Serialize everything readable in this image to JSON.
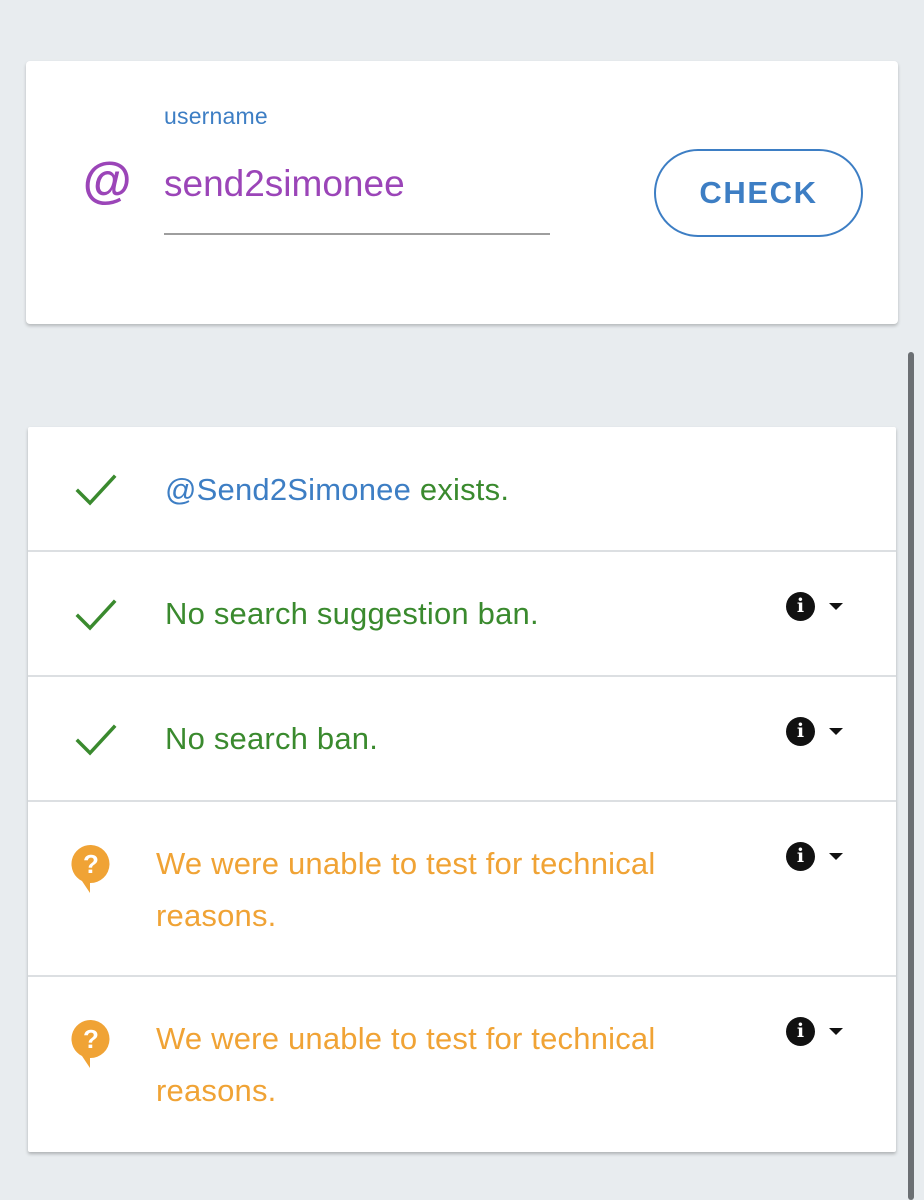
{
  "search": {
    "at_symbol": "@",
    "label": "username",
    "value": "send2simonee",
    "button_label": "CHECK"
  },
  "results": [
    {
      "status": "pass",
      "icon": "check-icon",
      "handle": "@Send2Simonee",
      "text": " exists.",
      "has_info": false
    },
    {
      "status": "pass",
      "icon": "check-icon",
      "text": "No search suggestion ban.",
      "has_info": true
    },
    {
      "status": "pass",
      "icon": "check-icon",
      "text": "No search ban.",
      "has_info": true
    },
    {
      "status": "unknown",
      "icon": "question-icon",
      "text_line1": "We were unable to test for technical",
      "text_line2": "reasons.",
      "has_info": true
    },
    {
      "status": "unknown",
      "icon": "question-icon",
      "text_line1": "We were unable to test for technical",
      "text_line2": "reasons.",
      "has_info": true
    }
  ],
  "colors": {
    "accent_blue": "#3d7ec4",
    "username_purple": "#9b45b8",
    "pass_green": "#3a8a2e",
    "unknown_orange": "#f0a335"
  }
}
